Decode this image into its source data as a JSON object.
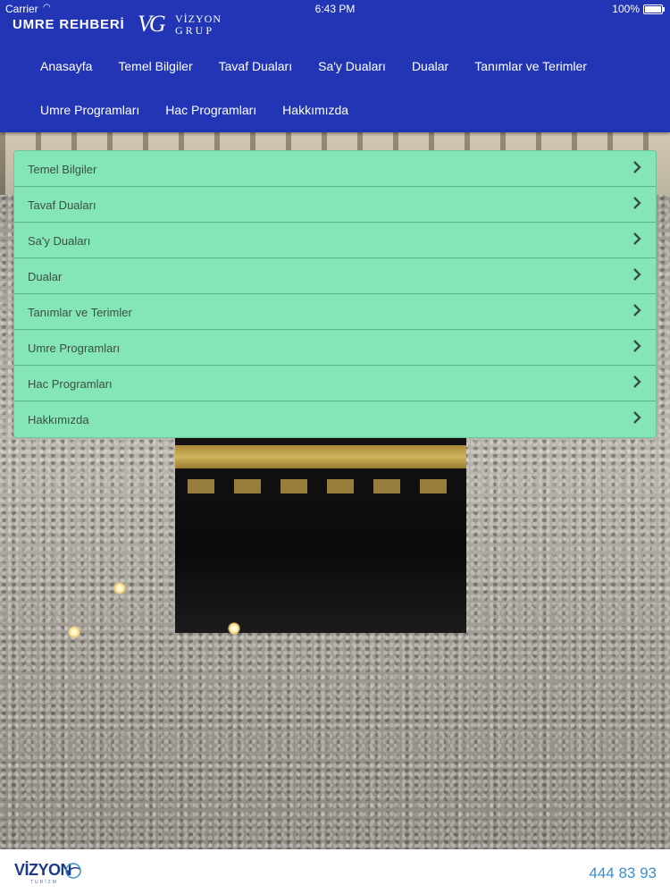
{
  "status_bar": {
    "carrier": "Carrier",
    "time": "6:43 PM",
    "battery": "100%"
  },
  "header": {
    "app_title": "UMRE REHBERİ",
    "logo": {
      "vg": "VG",
      "line1": "VİZYON",
      "line2": "GRUP"
    },
    "background_color": "#2236b5"
  },
  "nav": {
    "row1": [
      "Anasayfa",
      "Temel Bilgiler",
      "Tavaf Duaları",
      "Sa'y Duaları",
      "Dualar",
      "Tanımlar ve Terimler"
    ],
    "row2": [
      "Umre Programları",
      "Hac Programları",
      "Hakkımızda"
    ]
  },
  "menu": {
    "background_color": "#84e6b6",
    "items": [
      {
        "label": "Temel Bilgiler",
        "icon": "chevron-right-icon"
      },
      {
        "label": "Tavaf Duaları",
        "icon": "chevron-right-icon"
      },
      {
        "label": "Sa'y Duaları",
        "icon": "chevron-right-icon"
      },
      {
        "label": "Dualar",
        "icon": "chevron-right-icon"
      },
      {
        "label": "Tanımlar ve Terimler",
        "icon": "chevron-right-icon"
      },
      {
        "label": "Umre Programları",
        "icon": "chevron-right-icon"
      },
      {
        "label": "Hac Programları",
        "icon": "chevron-right-icon"
      },
      {
        "label": "Hakkımızda",
        "icon": "chevron-right-icon"
      }
    ]
  },
  "footer": {
    "logo_text": "VİZYON",
    "logo_sub": "TURİZM",
    "phone": "444 83 93"
  }
}
